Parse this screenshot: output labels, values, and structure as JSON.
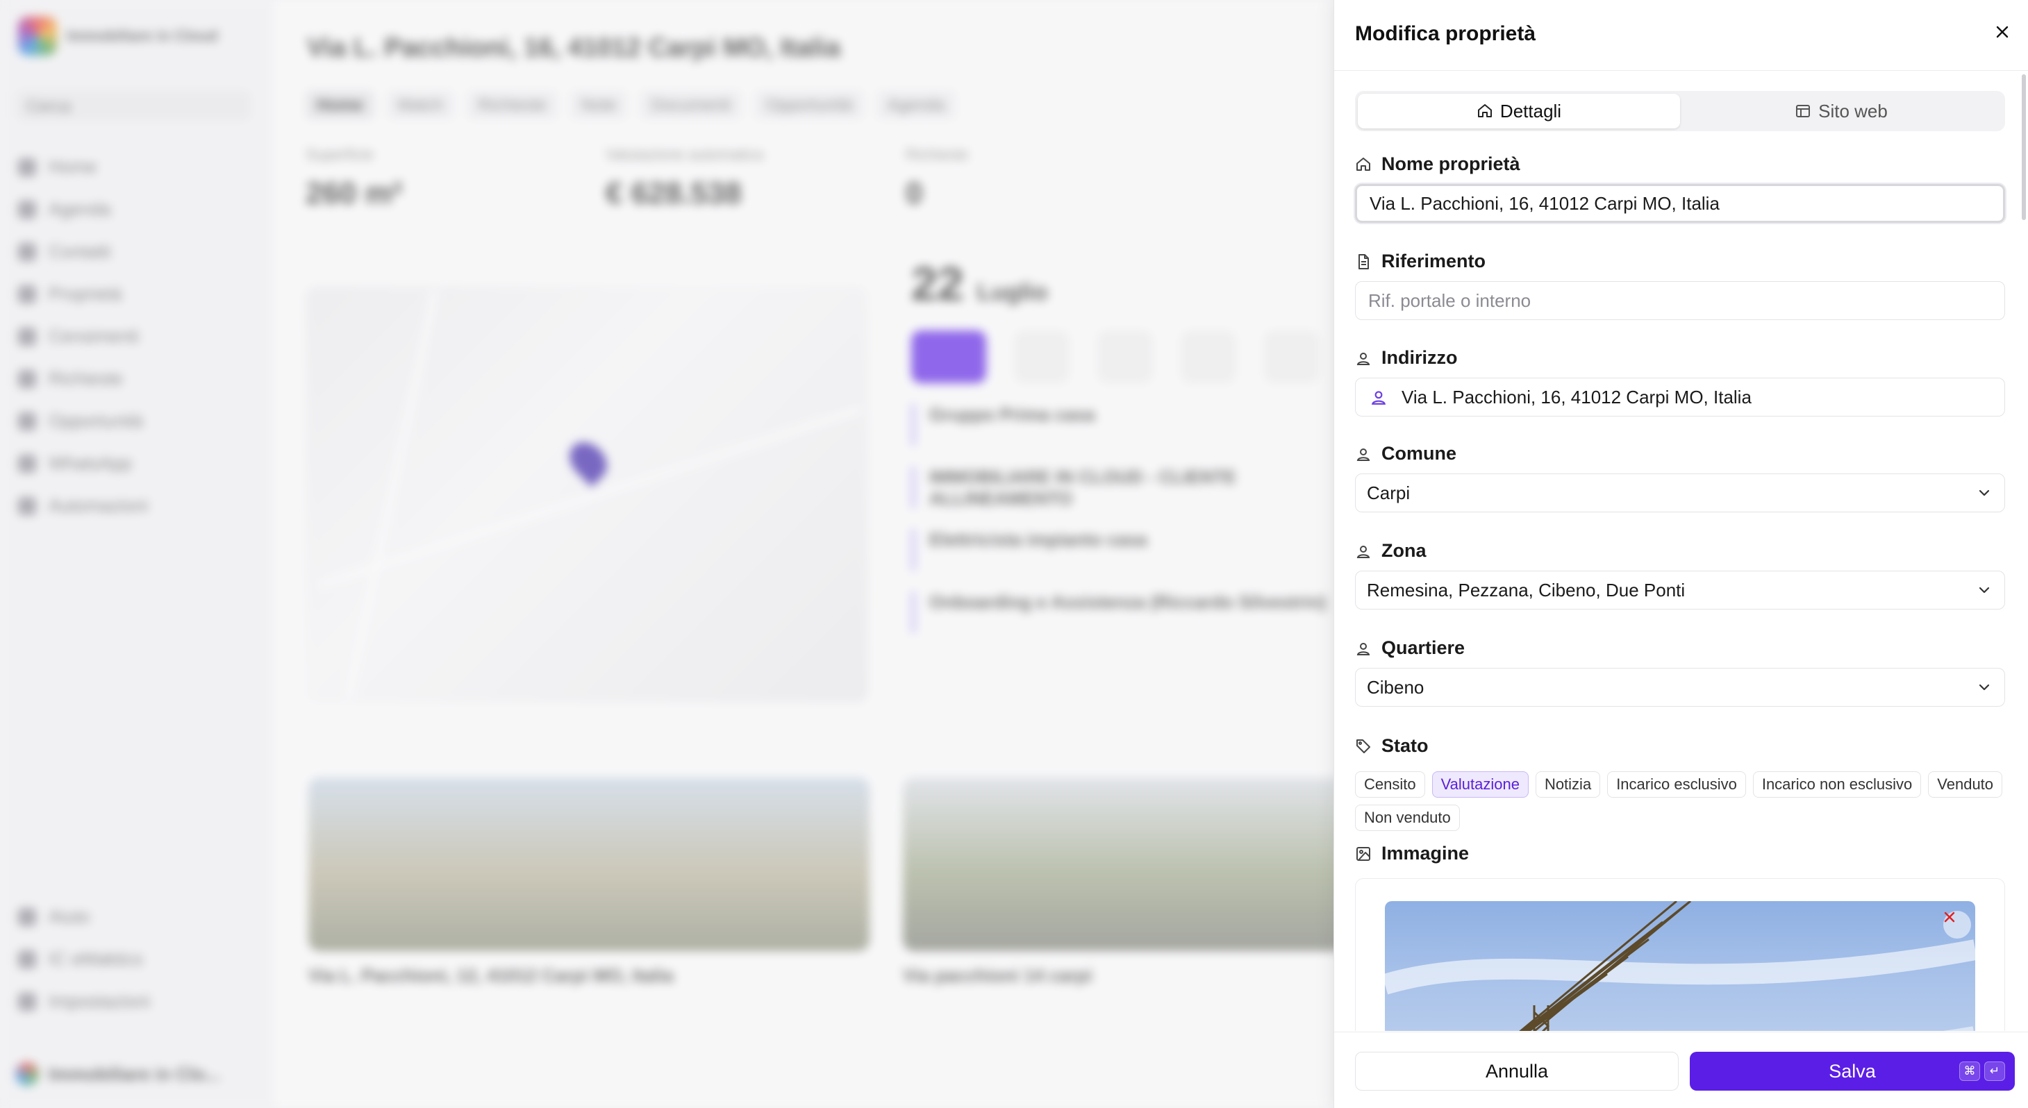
{
  "background": {
    "app_name": "Immobiliare in Cloud",
    "search_label": "Cerca",
    "nav_items": [
      "Home",
      "Agenda",
      "Contatti",
      "Proprietà",
      "Censimenti",
      "Richieste",
      "Opportunità",
      "WhatsApp",
      "Automazioni"
    ],
    "bottom_items": [
      "Aiuto",
      "IC eMaktics",
      "Impostazioni"
    ],
    "user_name": "Immobiliare in Clo...",
    "page_title": "Via L. Pacchioni, 16, 41012 Carpi MO, Italia",
    "tabs": [
      "Home",
      "Match",
      "Richieste",
      "Note",
      "Documenti",
      "Opportunità",
      "Agenda"
    ],
    "stats": [
      {
        "label": "Superficie",
        "value": "260 m²"
      },
      {
        "label": "Valutazione automatica",
        "value": "€ 628.538"
      },
      {
        "label": "Richieste",
        "value": "0"
      }
    ],
    "map_label": "Mappa",
    "agenda_label": "Agenda",
    "agenda_day": "22",
    "agenda_month": "Luglio",
    "events": [
      "Gruppo Prima casa",
      "IMMOBILIARE IN CLOUD - CLIENTE ALLINEAMENTO",
      "Elettricista impianto casa",
      "Onboarding e Assistenza (Riccardo Silvestrin)"
    ],
    "cards": [
      {
        "title": "Via L. Pacchioni, 12, 41012 Carpi MO, Italia"
      },
      {
        "title": "Via pacchioni 14 carpi"
      }
    ]
  },
  "panel": {
    "title": "Modifica proprietà",
    "close_icon": "close-icon",
    "tabs": [
      {
        "label": "Dettagli",
        "icon": "home-icon",
        "active": true
      },
      {
        "label": "Sito web",
        "icon": "browser-window-icon",
        "active": false
      }
    ],
    "fields": {
      "nome": {
        "label": "Nome proprietà",
        "value": "Via L. Pacchioni, 16, 41012 Carpi MO, Italia"
      },
      "riferimento": {
        "label": "Riferimento",
        "value": "",
        "placeholder": "Rif. portale o interno"
      },
      "indirizzo": {
        "label": "Indirizzo",
        "value": "Via L. Pacchioni, 16, 41012 Carpi MO, Italia"
      },
      "comune": {
        "label": "Comune",
        "value": "Carpi"
      },
      "zona": {
        "label": "Zona",
        "value": "Remesina, Pezzana, Cibeno, Due Ponti"
      },
      "quartiere": {
        "label": "Quartiere",
        "value": "Cibeno"
      },
      "stato": {
        "label": "Stato",
        "options": [
          "Censito",
          "Valutazione",
          "Notizia",
          "Incarico esclusivo",
          "Incarico non esclusivo",
          "Venduto",
          "Non venduto"
        ],
        "selected": "Valutazione"
      },
      "immagine": {
        "label": "Immagine"
      }
    },
    "footer": {
      "cancel_label": "Annulla",
      "save_label": "Salva",
      "shortcut_keys": [
        "⌘",
        "↵"
      ]
    }
  },
  "colors": {
    "accent": "#5b1ee6",
    "chip_selected_bg": "#efe9fd",
    "chip_selected_text": "#5b21d6"
  }
}
